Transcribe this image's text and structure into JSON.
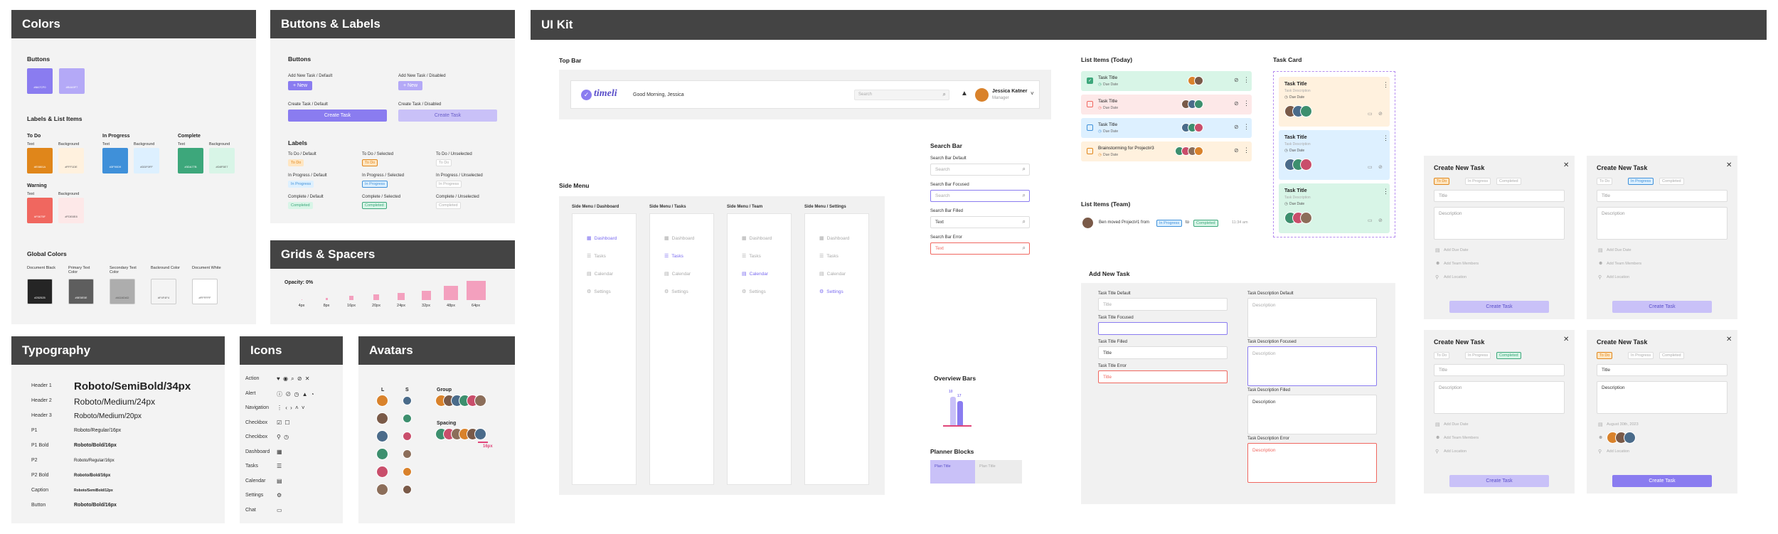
{
  "colors": {
    "title": "Colors",
    "buttons_title": "Buttons",
    "button_swatches": [
      {
        "hex": "#8A7CF0",
        "label": "#8A7CF0"
      },
      {
        "hex": "#B4A9F7",
        "label": "#B4A9F7"
      }
    ],
    "labels_title": "Labels & List Items",
    "groups": [
      {
        "name": "To Do",
        "text_label": "Text",
        "bg_label": "Background",
        "text": "#E0861A",
        "text_code": "#E0861A",
        "bg": "#FFF1DE",
        "bg_code": "#FFF1DE"
      },
      {
        "name": "In Progress",
        "text_label": "Text",
        "bg_label": "Background",
        "text": "#3F90D9",
        "text_code": "#3F90D9",
        "bg": "#DDF0FF",
        "bg_code": "#DDF0FF"
      },
      {
        "name": "Complete",
        "text_label": "Text",
        "bg_label": "Background",
        "text": "#3DA77B",
        "text_code": "#3DA77B",
        "bg": "#D8F5E7",
        "bg_code": "#D8F5E7"
      },
      {
        "name": "Warning",
        "text_label": "Text",
        "bg_label": "Background",
        "text": "#F0675F",
        "text_code": "#F0675F",
        "bg": "#FDE8E8",
        "bg_code": "#FDE8E8"
      }
    ],
    "global_title": "Global Colors",
    "global": [
      {
        "name": "Document Black",
        "hex": "#252525",
        "code": "#252525"
      },
      {
        "name": "Primary Text Color",
        "hex": "#5E5E5E",
        "code": "#5E5E5E"
      },
      {
        "name": "Secondary Text Color",
        "hex": "#ADADAD",
        "code": "#ADADAD"
      },
      {
        "name": "Backround Color",
        "hex": "#F4F4F4",
        "code": "#F4F4F4"
      },
      {
        "name": "Document White",
        "hex": "#FFFFFF",
        "code": "#FFFFFF"
      }
    ]
  },
  "buttons": {
    "title": "Buttons & Labels",
    "section": "Buttons",
    "add_default_label": "Add New Task / Default",
    "add_disabled_label": "Add New Task / Disabled",
    "new_text": "+ New",
    "create_default_label": "Create Task / Default",
    "create_disabled_label": "Create Task / Disabled",
    "create_text": "Create Task",
    "labels_section": "Labels",
    "labels": [
      {
        "cap": "To Do / Default",
        "pill": "To Do",
        "bg": "#FFE6C2",
        "fg": "#E0861A",
        "bd": "#FFE6C2"
      },
      {
        "cap": "To Do / Selected",
        "pill": "To Do",
        "bg": "#FFE6C2",
        "fg": "#E0861A",
        "bd": "#E0861A"
      },
      {
        "cap": "To Do / Unselected",
        "pill": "To Do",
        "bg": "#ffffff",
        "fg": "#AAAAAA",
        "bd": "#DDDDDD"
      },
      {
        "cap": "In Progress / Default",
        "pill": "In Progress",
        "bg": "#DDF0FF",
        "fg": "#3F90D9",
        "bd": "#DDF0FF"
      },
      {
        "cap": "In Progress / Selected",
        "pill": "In Progress",
        "bg": "#DDF0FF",
        "fg": "#3F90D9",
        "bd": "#3F90D9"
      },
      {
        "cap": "In Progress / Unselected",
        "pill": "In Progress",
        "bg": "#ffffff",
        "fg": "#AAAAAA",
        "bd": "#DDDDDD"
      },
      {
        "cap": "Complete / Default",
        "pill": "Completed",
        "bg": "#D8F5E7",
        "fg": "#3DA77B",
        "bd": "#D8F5E7"
      },
      {
        "cap": "Complete / Selected",
        "pill": "Completed",
        "bg": "#D8F5E7",
        "fg": "#3DA77B",
        "bd": "#3DA77B"
      },
      {
        "cap": "Complete / Unselected",
        "pill": "Completed",
        "bg": "#ffffff",
        "fg": "#AAAAAA",
        "bd": "#DDDDDD"
      }
    ]
  },
  "grids": {
    "title": "Grids & Spacers",
    "opacity": "Opacity: 0%",
    "spacers": [
      {
        "label": "4px",
        "size": 1
      },
      {
        "label": "8px",
        "size": 3
      },
      {
        "label": "16px",
        "size": 6
      },
      {
        "label": "20px",
        "size": 8
      },
      {
        "label": "24px",
        "size": 10
      },
      {
        "label": "32px",
        "size": 13
      },
      {
        "label": "48px",
        "size": 20
      },
      {
        "label": "64px",
        "size": 27
      }
    ]
  },
  "typography": {
    "title": "Typography",
    "rows": [
      {
        "label": "Header 1",
        "sample": "Roboto/SemiBold/34px",
        "size": 15,
        "weight": "bold"
      },
      {
        "label": "Header 2",
        "sample": "Roboto/Medium/24px",
        "size": 12,
        "weight": "normal"
      },
      {
        "label": "Header 3",
        "sample": "Roboto/Medium/20px",
        "size": 10,
        "weight": "normal"
      },
      {
        "label": "P1",
        "sample": "Roboto/Regular/16px",
        "size": 7,
        "weight": "normal"
      },
      {
        "label": "P1 Bold",
        "sample": "Roboto/Bold/16px",
        "size": 7,
        "weight": "bold"
      },
      {
        "label": "P2",
        "sample": "Roboto/Regular/16px",
        "size": 6,
        "weight": "normal"
      },
      {
        "label": "P2 Bold",
        "sample": "Roboto/Bold/16px",
        "size": 6,
        "weight": "bold"
      },
      {
        "label": "Caption",
        "sample": "Roboto/SemiBold/12px",
        "size": 5,
        "weight": "bold"
      },
      {
        "label": "Button",
        "sample": "Roboto/Bold/16px",
        "size": 7,
        "weight": "bold"
      }
    ]
  },
  "icons": {
    "title": "Icons",
    "rows": [
      {
        "label": "Action",
        "glyphs": "♥ ◉ ⌕ ⊘ ✕"
      },
      {
        "label": "Alert",
        "glyphs": "ⓘ ⊘ ◷ ▲ ◔"
      },
      {
        "label": "Navigation",
        "glyphs": "⋮ ‹ › ˄ ˅"
      },
      {
        "label": "Checkbox",
        "glyphs": "☑ ☐"
      },
      {
        "label": "Checkbox",
        "glyphs": "⚲ ◷"
      },
      {
        "label": "Dashboard",
        "glyphs": "▦"
      },
      {
        "label": "Tasks",
        "glyphs": "☰"
      },
      {
        "label": "Calendar",
        "glyphs": "▤"
      },
      {
        "label": "Settings",
        "glyphs": "⚙"
      },
      {
        "label": "Chat",
        "glyphs": "▭"
      }
    ]
  },
  "avatars": {
    "title": "Avatars",
    "col_l": "L",
    "col_s": "S",
    "group_label": "Group",
    "spacing_label": "Spacing",
    "spacing_value": "16px",
    "palette": [
      "#D9822B",
      "#7A5A48",
      "#4A6B8A",
      "#3D8F6E",
      "#C94E6B",
      "#8C6E5A"
    ]
  },
  "uikit": {
    "title": "UI Kit",
    "topbar_label": "Top Bar",
    "logo": "timeli",
    "greeting": "Good Morning, Jessica",
    "search_placeholder": "Search",
    "user_name": "Jessica Katner",
    "user_role": "Manager",
    "sidemenu_label": "Side Menu",
    "sidemenus": [
      {
        "caption": "Side Menu / Dashboard",
        "active": 0
      },
      {
        "caption": "Side Menu / Tasks",
        "active": 1
      },
      {
        "caption": "Side Menu / Team",
        "active": 2
      },
      {
        "caption": "Side Menu / Settings",
        "active": 3
      }
    ],
    "menu_items": [
      "Dashboard",
      "Tasks",
      "Calendar",
      "Settings"
    ],
    "searchbar_label": "Search Bar",
    "search_states": [
      {
        "cap": "Search Bar Default",
        "text": "Search",
        "border": "#dddddd",
        "fg": "#aaaaaa"
      },
      {
        "cap": "Search Bar Focused",
        "text": "Search",
        "border": "#8A7CF0",
        "fg": "#aaaaaa"
      },
      {
        "cap": "Search Bar Filled",
        "text": "Text",
        "border": "#dddddd",
        "fg": "#333333"
      },
      {
        "cap": "Search Bar Error",
        "text": "Text",
        "border": "#F0675F",
        "fg": "#F0675F"
      }
    ],
    "overview_label": "Overview Bars",
    "overview_values": [
      "10",
      "17"
    ],
    "planner_label": "Planner Blocks",
    "planner_title": "Plan Title",
    "list_today_label": "List Items (Today)",
    "list_today": [
      {
        "title": "Task Title",
        "date": "Due Date",
        "bg": "#D8F5E7",
        "color": "#3DA77B",
        "checked": true
      },
      {
        "title": "Task Title",
        "date": "Due Date",
        "bg": "#FDE8E8",
        "color": "#F0675F",
        "checked": false
      },
      {
        "title": "Task Title",
        "date": "Due Date",
        "bg": "#DDF0FF",
        "color": "#3F90D9",
        "checked": false
      },
      {
        "title": "Brainstorming for Project#3",
        "date": "Due Date",
        "bg": "#FFF1DE",
        "color": "#E0861A",
        "checked": false
      }
    ],
    "list_team_label": "List Items (Team)",
    "team_text": "Ben moved Project#1 from",
    "team_from": "In Progress",
    "team_to_word": "to",
    "team_to": "Completed",
    "team_time": "11:34 am",
    "taskcard_label": "Task Card",
    "task_cards": [
      {
        "title": "Task Title",
        "desc": "Task Description",
        "date": "Due Date",
        "bg": "#FFF1DE"
      },
      {
        "title": "Task Title",
        "desc": "Task Description",
        "date": "Due Date",
        "bg": "#DDF0FF"
      },
      {
        "title": "Task Title",
        "desc": "Task Description",
        "date": "Due Date",
        "bg": "#D8F5E7"
      }
    ],
    "addtask_label": "Add New Task",
    "title_fields": [
      {
        "cap": "Task Title Default",
        "text": "Title",
        "border": "#dddddd",
        "fg": "#aaaaaa"
      },
      {
        "cap": "Task Title Focused",
        "text": "",
        "border": "#8A7CF0",
        "fg": "#aaaaaa"
      },
      {
        "cap": "Task Title Filled",
        "text": "Title",
        "border": "#dddddd",
        "fg": "#333333"
      },
      {
        "cap": "Task Title Error",
        "text": "Title",
        "border": "#F0675F",
        "fg": "#F0675F"
      }
    ],
    "desc_fields": [
      {
        "cap": "Task Description Default",
        "text": "Description",
        "border": "#dddddd",
        "fg": "#aaaaaa"
      },
      {
        "cap": "Task Description Focused",
        "text": "Description",
        "border": "#8A7CF0",
        "fg": "#aaaaaa"
      },
      {
        "cap": "Task Description Filled",
        "text": "Description",
        "border": "#dddddd",
        "fg": "#333333"
      },
      {
        "cap": "Task Description Error",
        "text": "Description",
        "border": "#F0675F",
        "fg": "#F0675F"
      }
    ],
    "create_modal_title": "Create New Task",
    "modal_status": [
      "To Do",
      "In Progress",
      "Completed"
    ],
    "modal_title_ph": "Title",
    "modal_desc_ph": "Description",
    "modal_due": "Add Due Date",
    "modal_team": "Add Team Members",
    "modal_location": "Add Location",
    "modal_create": "Create Task",
    "modal_filled_title": "Title",
    "modal_filled_desc": "Description",
    "modal_filled_date": "August 30th, 2023",
    "modals": [
      {
        "active": 0,
        "filled": false,
        "enabled": false
      },
      {
        "active": 1,
        "filled": false,
        "enabled": false
      },
      {
        "active": 2,
        "filled": false,
        "enabled": false
      },
      {
        "active": 0,
        "filled": true,
        "enabled": true
      }
    ]
  }
}
